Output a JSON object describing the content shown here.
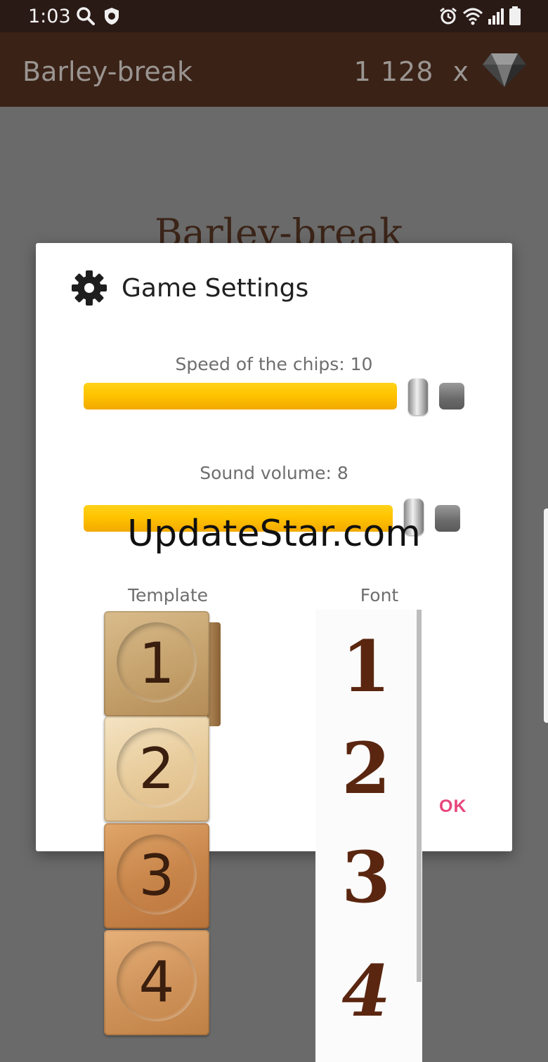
{
  "status_bar": {
    "time": "1:03",
    "left_icons": [
      "search-icon",
      "shield-icon"
    ],
    "right_icons": [
      "alarm-icon",
      "wifi-icon",
      "signal-icon",
      "battery-icon"
    ]
  },
  "app_bar": {
    "title": "Barley-break",
    "coin_count": "1 128",
    "multiplier": "x",
    "icon": "diamond-icon"
  },
  "background": {
    "title": "Barley-break"
  },
  "dialog": {
    "icon": "gear-icon",
    "title": "Game Settings",
    "speed": {
      "label": "Speed of the chips: 10",
      "value": 10,
      "fill": 0.84
    },
    "volume": {
      "label": "Sound volume: 8",
      "value": 8,
      "fill": 0.83
    },
    "template_label": "Template",
    "font_label": "Font",
    "ok_label": "OK"
  },
  "templates": [
    "1",
    "2",
    "3",
    "4"
  ],
  "fonts": [
    "1",
    "2",
    "3",
    "4"
  ],
  "watermark": "UpdateStar.com",
  "colors": {
    "app_bar": "#3a2217",
    "status_bar": "#2a1a16",
    "slider_fill": "#ffc400",
    "ok": "#e8467c"
  }
}
